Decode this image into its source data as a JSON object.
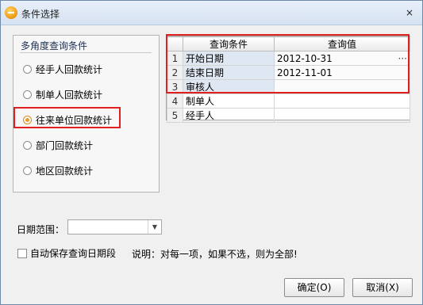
{
  "window": {
    "title": "条件选择",
    "close_glyph": "×"
  },
  "group": {
    "title": "多角度查询条件",
    "options": [
      {
        "label": "经手人回款统计",
        "checked": false
      },
      {
        "label": "制单人回款统计",
        "checked": false
      },
      {
        "label": "往来单位回款统计",
        "checked": true
      },
      {
        "label": "部门回款统计",
        "checked": false
      },
      {
        "label": "地区回款统计",
        "checked": false
      }
    ]
  },
  "grid": {
    "headers": [
      "",
      "查询条件",
      "查询值"
    ],
    "rows": [
      {
        "idx": "1",
        "cond": "开始日期",
        "val": "2012-10-31",
        "button": "···"
      },
      {
        "idx": "2",
        "cond": "结束日期",
        "val": "2012-11-01",
        "button": ""
      },
      {
        "idx": "3",
        "cond": "审核人",
        "val": "",
        "button": ""
      },
      {
        "idx": "4",
        "cond": "制单人",
        "val": "",
        "button": ""
      },
      {
        "idx": "5",
        "cond": "经手人",
        "val": "",
        "button": ""
      }
    ]
  },
  "date_range": {
    "label": "日期范围：",
    "value": "",
    "arrow": "▼"
  },
  "autosave": {
    "label": "自动保存查询日期段",
    "checked": false
  },
  "note": "说明：对每一项，如果不选，则为全部!",
  "buttons": {
    "ok": "确定(O)",
    "cancel": "取消(X)"
  },
  "colors": {
    "highlight": "#e01f1f",
    "accent": "#e99a2b"
  },
  "icons": {
    "app": "app-icon",
    "close": "close-icon"
  }
}
